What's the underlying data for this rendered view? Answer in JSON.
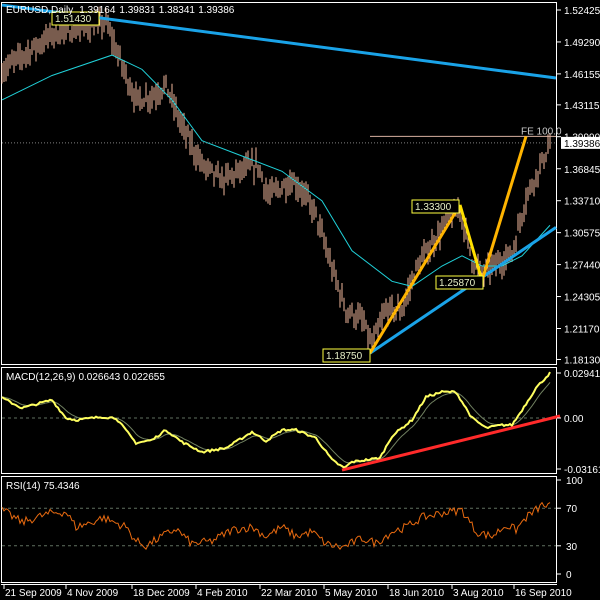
{
  "window": {
    "symbol_title": "EURUSD,Daily",
    "ohlc": [
      "1.39164",
      "1.39831",
      "1.38341",
      "1.39386"
    ]
  },
  "colors": {
    "background": "#000000",
    "bars": "#f2b89c",
    "ma": "#20d0d8",
    "trendline": "#1aa3e8",
    "zigzag": "#ffb400",
    "zigzag_mid": "#ffe000",
    "macd": "#ffff60",
    "macd_signal": "#708060",
    "macd_trend": "#ff2a2a",
    "rsi": "#e86a10",
    "frame": "#ffffff"
  },
  "chart_data": [
    {
      "type": "line",
      "title": "EURUSD,Daily",
      "series_kind": "ohlc-bars",
      "x_unit": "bar index (daily)",
      "price_close_keypoints": [
        [
          0,
          1.465
        ],
        [
          25,
          1.5
        ],
        [
          52,
          1.512
        ],
        [
          60,
          1.47
        ],
        [
          67,
          1.436
        ],
        [
          75,
          1.44
        ],
        [
          82,
          1.45
        ],
        [
          90,
          1.41
        ],
        [
          100,
          1.372
        ],
        [
          110,
          1.357
        ],
        [
          120,
          1.367
        ],
        [
          128,
          1.372
        ],
        [
          133,
          1.342
        ],
        [
          145,
          1.357
        ],
        [
          150,
          1.347
        ],
        [
          157,
          1.323
        ],
        [
          165,
          1.27
        ],
        [
          172,
          1.23
        ],
        [
          180,
          1.22
        ],
        [
          185,
          1.195
        ],
        [
          192,
          1.23
        ],
        [
          200,
          1.23
        ],
        [
          207,
          1.27
        ],
        [
          215,
          1.295
        ],
        [
          222,
          1.315
        ],
        [
          229,
          1.33
        ],
        [
          235,
          1.28
        ],
        [
          240,
          1.265
        ],
        [
          247,
          1.275
        ],
        [
          255,
          1.285
        ],
        [
          262,
          1.34
        ],
        [
          270,
          1.375
        ],
        [
          274,
          1.393
        ]
      ],
      "moving_average_keypoints": [
        [
          0,
          1.436
        ],
        [
          25,
          1.46
        ],
        [
          55,
          1.48
        ],
        [
          70,
          1.466
        ],
        [
          85,
          1.436
        ],
        [
          100,
          1.396
        ],
        [
          120,
          1.381
        ],
        [
          140,
          1.366
        ],
        [
          160,
          1.337
        ],
        [
          175,
          1.288
        ],
        [
          195,
          1.258
        ],
        [
          205,
          1.253
        ],
        [
          220,
          1.273
        ],
        [
          230,
          1.283
        ],
        [
          240,
          1.273
        ],
        [
          250,
          1.273
        ],
        [
          260,
          1.283
        ],
        [
          274,
          1.313
        ]
      ],
      "y_axis_ticks": [
        "1.52425",
        "1.49290",
        "1.46155",
        "1.43115",
        "1.39990",
        "1.36845",
        "1.33710",
        "1.30575",
        "1.27440",
        "1.24305",
        "1.21170",
        "1.18130"
      ],
      "current_price_label": "1.39386",
      "current_price": 1.39386,
      "ylim": [
        1.1775,
        1.5311
      ],
      "annotations": [
        {
          "text": "1.51430",
          "bar": 52,
          "price": 1.5143
        },
        {
          "text": "1.33300",
          "bar": 229,
          "price": 1.333
        },
        {
          "text": "1.25870",
          "bar": 240,
          "price": 1.2587
        },
        {
          "text": "1.18750",
          "bar": 184,
          "price": 1.1875
        }
      ],
      "fibo_expansion": {
        "label": "FE 100.0",
        "price": 1.4002,
        "from_bar": 184
      },
      "zigzag": [
        [
          184,
          1.1875
        ],
        [
          229,
          1.333
        ],
        [
          240,
          1.2587
        ],
        [
          262,
          1.4002
        ]
      ],
      "trendlines": [
        {
          "name": "upper",
          "points": [
            [
              0,
              1.5291
            ],
            [
              277,
              1.4575
            ]
          ]
        },
        {
          "name": "lower",
          "points": [
            [
              184,
              1.1875
            ],
            [
              277,
              1.3109
            ]
          ]
        }
      ],
      "x_ticks": [
        "21 Sep 2009",
        "4 Nov 2009",
        "18 Dec 2009",
        "4 Feb 2010",
        "22 Mar 2010",
        "5 May 2010",
        "18 Jun 2010",
        "3 Aug 2010",
        "16 Sep 2010"
      ],
      "x_tick_bars": [
        1,
        32,
        65,
        97,
        129,
        161,
        193,
        225,
        256
      ]
    },
    {
      "type": "line",
      "title": "MACD(12,26,9)",
      "values_label": [
        "0.026643",
        "0.022655"
      ],
      "y_axis_ticks": [
        "0.029417",
        "0.00",
        "-0.03161"
      ],
      "ylim": [
        -0.0336,
        0.0327
      ],
      "macd_keypoints": [
        [
          0,
          0.0131
        ],
        [
          10,
          0.0065
        ],
        [
          25,
          0.0118
        ],
        [
          32,
          0.0
        ],
        [
          37,
          -0.0013
        ],
        [
          50,
          0.0007
        ],
        [
          57,
          0.0
        ],
        [
          67,
          -0.0163
        ],
        [
          75,
          -0.0144
        ],
        [
          82,
          -0.0078
        ],
        [
          90,
          -0.0157
        ],
        [
          100,
          -0.0222
        ],
        [
          112,
          -0.0196
        ],
        [
          125,
          -0.0091
        ],
        [
          132,
          -0.015
        ],
        [
          140,
          -0.0078
        ],
        [
          147,
          -0.0078
        ],
        [
          157,
          -0.0131
        ],
        [
          165,
          -0.0274
        ],
        [
          171,
          -0.0327
        ],
        [
          175,
          -0.0287
        ],
        [
          182,
          -0.0274
        ],
        [
          189,
          -0.0261
        ],
        [
          195,
          -0.0118
        ],
        [
          205,
          -0.0013
        ],
        [
          212,
          0.0137
        ],
        [
          220,
          0.017
        ],
        [
          227,
          0.017
        ],
        [
          235,
          0.0
        ],
        [
          242,
          -0.0065
        ],
        [
          250,
          -0.0046
        ],
        [
          255,
          -0.0046
        ],
        [
          260,
          0.0052
        ],
        [
          267,
          0.0196
        ],
        [
          274,
          0.0294
        ]
      ],
      "trendline": [
        [
          170,
          -0.034
        ],
        [
          280,
          0.0013
        ]
      ]
    },
    {
      "type": "line",
      "title": "RSI(14)",
      "value_label": "75.4346",
      "y_axis_ticks": [
        "100",
        "70",
        "30",
        "0"
      ],
      "levels": [
        70,
        30
      ],
      "ylim": [
        0,
        100
      ],
      "rsi_keypoints": [
        [
          0,
          68
        ],
        [
          10,
          55
        ],
        [
          20,
          62
        ],
        [
          25,
          65
        ],
        [
          32,
          66
        ],
        [
          37,
          50
        ],
        [
          45,
          55
        ],
        [
          50,
          60
        ],
        [
          55,
          56
        ],
        [
          62,
          50
        ],
        [
          67,
          35
        ],
        [
          72,
          30
        ],
        [
          80,
          40
        ],
        [
          87,
          48
        ],
        [
          95,
          32
        ],
        [
          105,
          35
        ],
        [
          115,
          47
        ],
        [
          125,
          50
        ],
        [
          132,
          40
        ],
        [
          140,
          50
        ],
        [
          147,
          40
        ],
        [
          155,
          45
        ],
        [
          162,
          32
        ],
        [
          170,
          28
        ],
        [
          180,
          38
        ],
        [
          187,
          33
        ],
        [
          195,
          45
        ],
        [
          202,
          50
        ],
        [
          210,
          60
        ],
        [
          220,
          65
        ],
        [
          230,
          68
        ],
        [
          237,
          45
        ],
        [
          245,
          40
        ],
        [
          252,
          52
        ],
        [
          257,
          47
        ],
        [
          262,
          60
        ],
        [
          270,
          73
        ],
        [
          274,
          72
        ]
      ]
    }
  ]
}
